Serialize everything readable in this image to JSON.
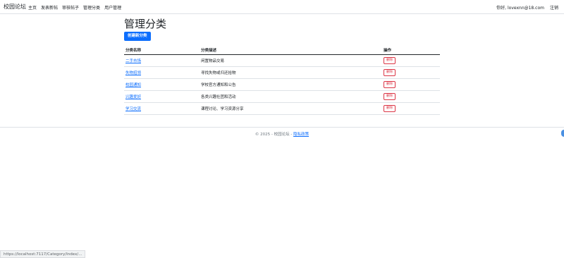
{
  "nav": {
    "brand": "校园论坛",
    "links": [
      "主页",
      "发表新帖",
      "审核帖子",
      "管理分类",
      "用户管理"
    ],
    "greeting": "你好, lovexnn@18.com",
    "logout": "注销"
  },
  "page": {
    "title": "管理分类",
    "create_label": "创建新分类"
  },
  "table": {
    "headers": [
      "分类名称",
      "分类描述",
      "操作"
    ],
    "rows": [
      {
        "name": "二手市场",
        "desc": "闲置物品交易",
        "action": "删除"
      },
      {
        "name": "失物招领",
        "desc": "寻找失物或归还拾物",
        "action": "删除"
      },
      {
        "name": "校园通知",
        "desc": "学校官方通知和公告",
        "action": "删除"
      },
      {
        "name": "兴趣爱好",
        "desc": "各类兴趣社团和活动",
        "action": "删除"
      },
      {
        "name": "学习交流",
        "desc": "课程讨论、学习资源分享",
        "action": "删除"
      }
    ]
  },
  "footer": {
    "text": "© 2025 - 校园论坛 -",
    "privacy": "隐私政策"
  },
  "status": {
    "url": "https://localhost:7117/Category/Index/..."
  },
  "colors": {
    "primary": "#0d6efd",
    "danger": "#dc3545"
  }
}
